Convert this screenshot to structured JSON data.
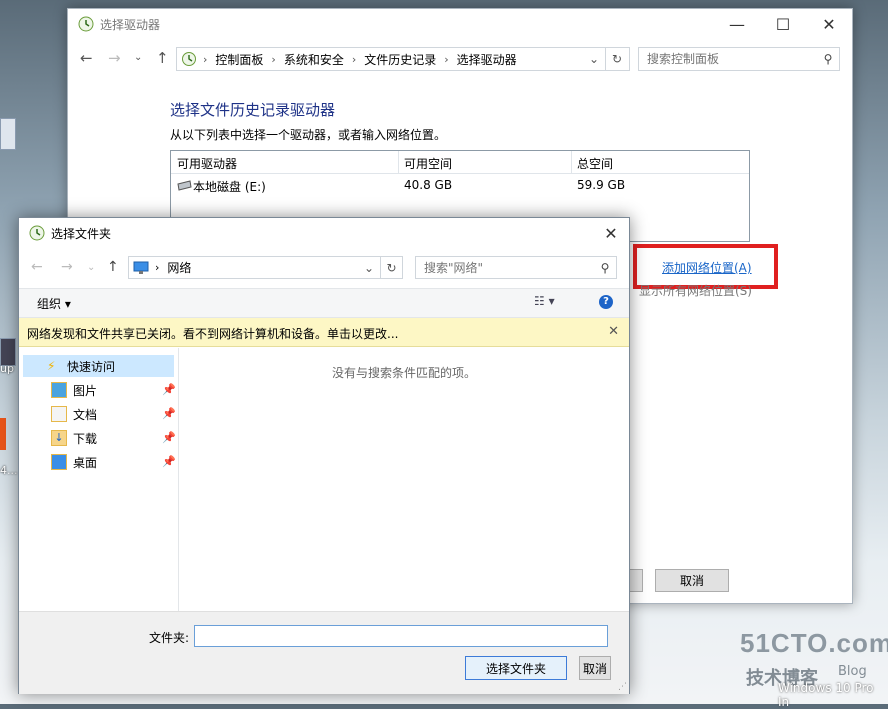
{
  "desktop": {
    "fragments": [
      "up",
      "4..."
    ],
    "watermark": {
      "site": "51CTO.com",
      "slogan": "技术博客",
      "blog": "Blog"
    },
    "os_label": "Windows 10 Pro In"
  },
  "main_window": {
    "title": "选择驱动器",
    "controls": {
      "minimize": "—",
      "maximize": "☐",
      "close": "✕"
    },
    "breadcrumbs": [
      "控制面板",
      "系统和安全",
      "文件历史记录",
      "选择驱动器"
    ],
    "search_placeholder": "搜索控制面板",
    "heading": "选择文件历史记录驱动器",
    "subheading": "从以下列表中选择一个驱动器，或者输入网络位置。",
    "table": {
      "headers": [
        "可用驱动器",
        "可用空间",
        "总空间"
      ],
      "rows": [
        {
          "name": "本地磁盘 (E:)",
          "free": "40.8 GB",
          "total": "59.9 GB"
        }
      ]
    },
    "add_network_link": "添加网络位置(A)",
    "show_all_network": "显示所有网络位置(S)",
    "cancel_label": "取消"
  },
  "folder_dialog": {
    "title": "选择文件夹",
    "address": "网络",
    "search_placeholder": "搜索\"网络\"",
    "organize_label": "组织 ▾",
    "infobar_text": "网络发现和文件共享已关闭。看不到网络计算机和设备。单击以更改...",
    "nav": {
      "quick_access": "快速访问",
      "items": [
        "图片",
        "文档",
        "下载",
        "桌面"
      ]
    },
    "empty_message": "没有与搜索条件匹配的项。",
    "folder_label": "文件夹:",
    "folder_value": "",
    "select_button": "选择文件夹",
    "cancel_button": "取消"
  },
  "colors": {
    "heading": "#1e3287",
    "link": "#1a66c8",
    "highlight_box": "#e02020",
    "infobar": "#fdf7c5",
    "quick_access_bg": "#cce8ff"
  }
}
